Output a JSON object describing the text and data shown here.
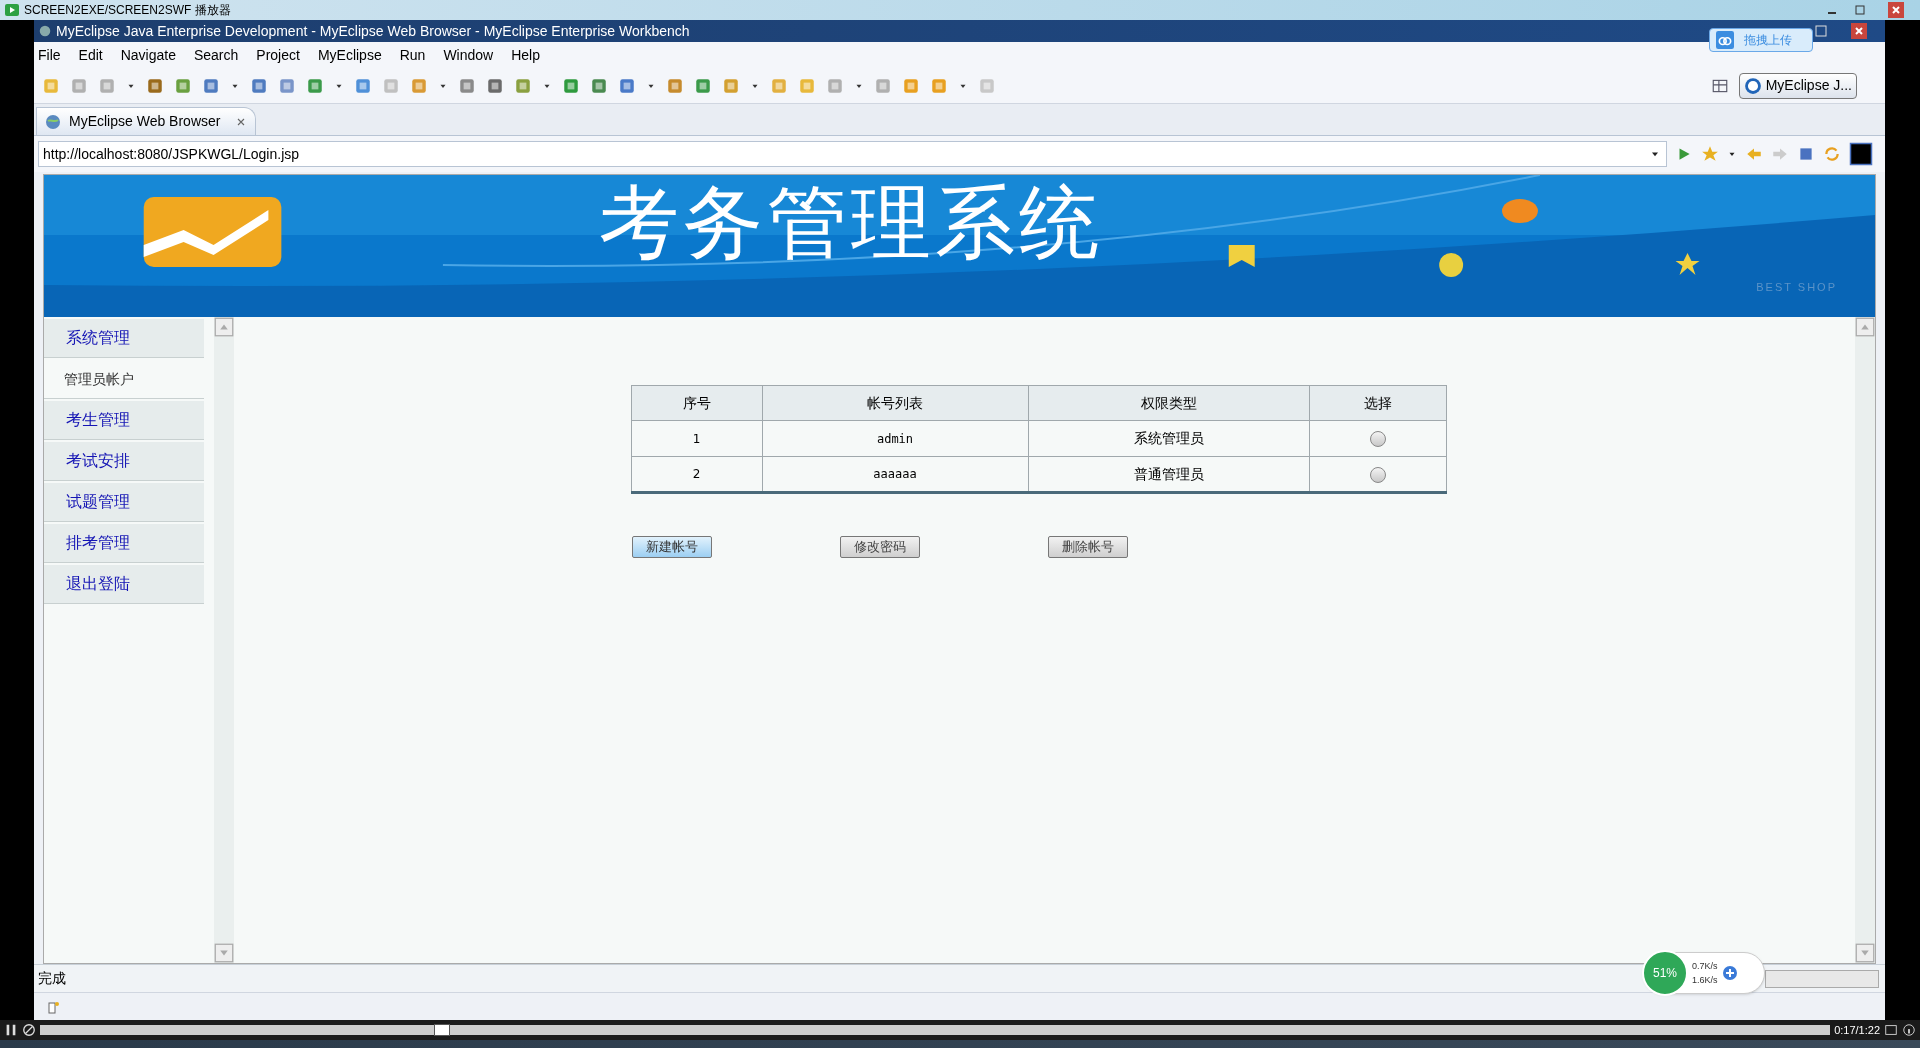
{
  "player": {
    "title": "SCREEN2EXE/SCREEN2SWF 播放器",
    "time": "0:17/1:22",
    "level": 0.22
  },
  "window": {
    "title": "MyEclipse Java Enterprise Development - MyEclipse Web Browser - MyEclipse Enterprise Workbench"
  },
  "upload_badge": "拖拽上传",
  "menu": [
    "File",
    "Edit",
    "Navigate",
    "Search",
    "Project",
    "MyEclipse",
    "Run",
    "Window",
    "Help"
  ],
  "perspective": "MyEclipse J...",
  "tab": {
    "label": "MyEclipse Web Browser"
  },
  "address": "http://localhost:8080/JSPKWGL/Login.jsp",
  "banner": {
    "title": "考务管理系统",
    "tagline": "BEST SHOP"
  },
  "sidebar": [
    {
      "label": "系统管理",
      "kind": "section",
      "selected": false
    },
    {
      "label": "管理员帐户",
      "kind": "sub",
      "selected": true
    },
    {
      "label": "考生管理",
      "kind": "section",
      "selected": false
    },
    {
      "label": "考试安排",
      "kind": "section",
      "selected": false
    },
    {
      "label": "试题管理",
      "kind": "section",
      "selected": false
    },
    {
      "label": "排考管理",
      "kind": "section",
      "selected": false
    },
    {
      "label": "退出登陆",
      "kind": "section",
      "selected": false
    }
  ],
  "table": {
    "columns": [
      "序号",
      "帐号列表",
      "权限类型",
      "选择"
    ],
    "rows": [
      {
        "cells": [
          "1",
          "admin",
          "系统管理员"
        ],
        "selected": false
      },
      {
        "cells": [
          "2",
          "aaaaaa",
          "普通管理员"
        ],
        "selected": false
      }
    ]
  },
  "buttons": [
    {
      "label": "新建帐号",
      "hovered": true
    },
    {
      "label": "修改密码",
      "hovered": false
    },
    {
      "label": "删除帐号",
      "hovered": false
    }
  ],
  "status": "完成",
  "network": {
    "percent": "51%",
    "up": "0.7K/s",
    "down": "1.6K/s"
  }
}
